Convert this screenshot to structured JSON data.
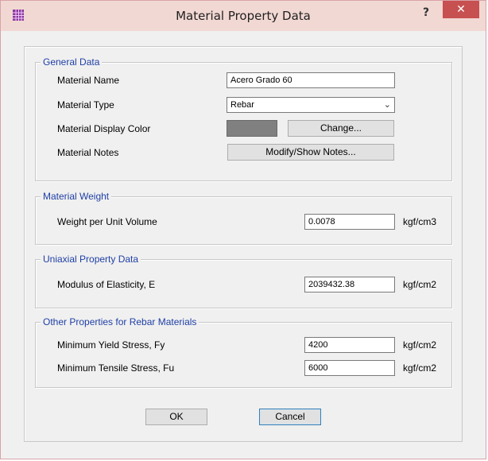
{
  "window": {
    "title": "Material Property Data",
    "help_label": "?",
    "close_label": "✕"
  },
  "general": {
    "title": "General Data",
    "name_label": "Material Name",
    "name_value": "Acero Grado 60",
    "type_label": "Material Type",
    "type_value": "Rebar",
    "color_label": "Material Display Color",
    "display_color": "#808080",
    "change_label": "Change...",
    "notes_label": "Material Notes",
    "notes_button": "Modify/Show Notes..."
  },
  "weight": {
    "title": "Material Weight",
    "label": "Weight per Unit Volume",
    "value": "0.0078",
    "unit": "kgf/cm3"
  },
  "uniaxial": {
    "title": "Uniaxial Property Data",
    "label": "Modulus of Elasticity,  E",
    "value": "2039432.38",
    "unit": "kgf/cm2"
  },
  "rebar": {
    "title": "Other Properties for Rebar Materials",
    "fy_label": "Minimum Yield Stress, Fy",
    "fy_value": "4200",
    "fy_unit": "kgf/cm2",
    "fu_label": "Minimum Tensile Stress, Fu",
    "fu_value": "6000",
    "fu_unit": "kgf/cm2"
  },
  "buttons": {
    "ok": "OK",
    "cancel": "Cancel"
  },
  "colors": {
    "group_title": "#1f3fa5",
    "titlebar": "#f2d8d3",
    "close_button": "#c75050"
  }
}
